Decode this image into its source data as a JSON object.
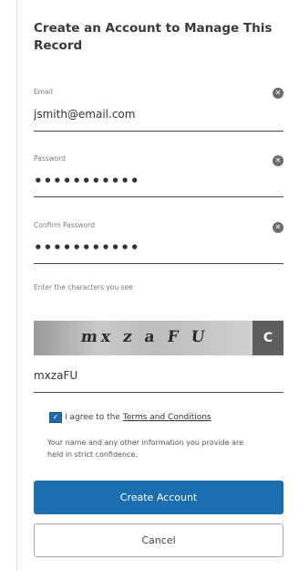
{
  "form": {
    "title": "Create an Account to Manage This Record",
    "email": {
      "label": "Email",
      "value": "jsmith@email.com"
    },
    "password": {
      "label": "Password",
      "value": "•••••••••••"
    },
    "confirm_password": {
      "label": "Confirm Password",
      "value": "•••••••••••"
    },
    "clear_icon_glyph": "✕",
    "captcha": {
      "hint": "Enter the characters you see",
      "image_text": "mx z a F U",
      "refresh_glyph": "C",
      "answer": "mxzaFU"
    },
    "agree": {
      "checked": true,
      "check_glyph": "✓",
      "text": "I agree to the",
      "link": "Terms and Conditions"
    },
    "privacy_note": "Your name and any other information you provide are held in strict confidence.",
    "create_button": "Create Account",
    "cancel_button": "Cancel"
  },
  "colors": {
    "primary": "#1b6fb0",
    "field_border": "#4a4a4a",
    "label": "#7c7c7c"
  }
}
